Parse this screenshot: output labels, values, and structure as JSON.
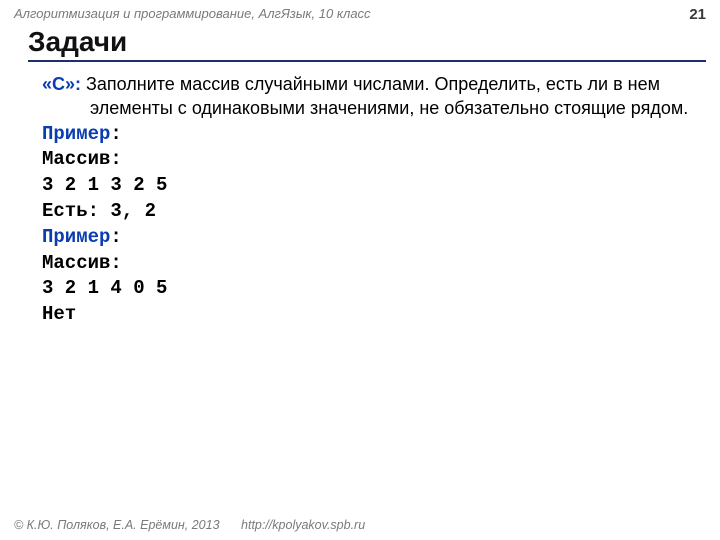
{
  "meta": {
    "header": "Алгоритмизация и программирование, АлгЯзык, 10 класс",
    "pagenum": "21",
    "title": "Задачи",
    "footer_authors": "© К.Ю. Поляков, Е.А. Ерёмин, 2013",
    "footer_url": "http://kpolyakov.spb.ru"
  },
  "task": {
    "label": "«С»:",
    "text": " Заполните массив случайными числами. Определить, есть ли в нем элементы с одинаковыми значениями, не обязательно стоящие рядом."
  },
  "example1": {
    "label": "Пример",
    "colon": ":",
    "line1": "Массив:",
    "line2": "3 2 1 3 2 5",
    "line3": "Есть: 3, 2"
  },
  "example2": {
    "label": "Пример",
    "colon": ":",
    "line1": "Массив:",
    "line2": "3 2 1 4 0 5",
    "line3": "Нет"
  }
}
